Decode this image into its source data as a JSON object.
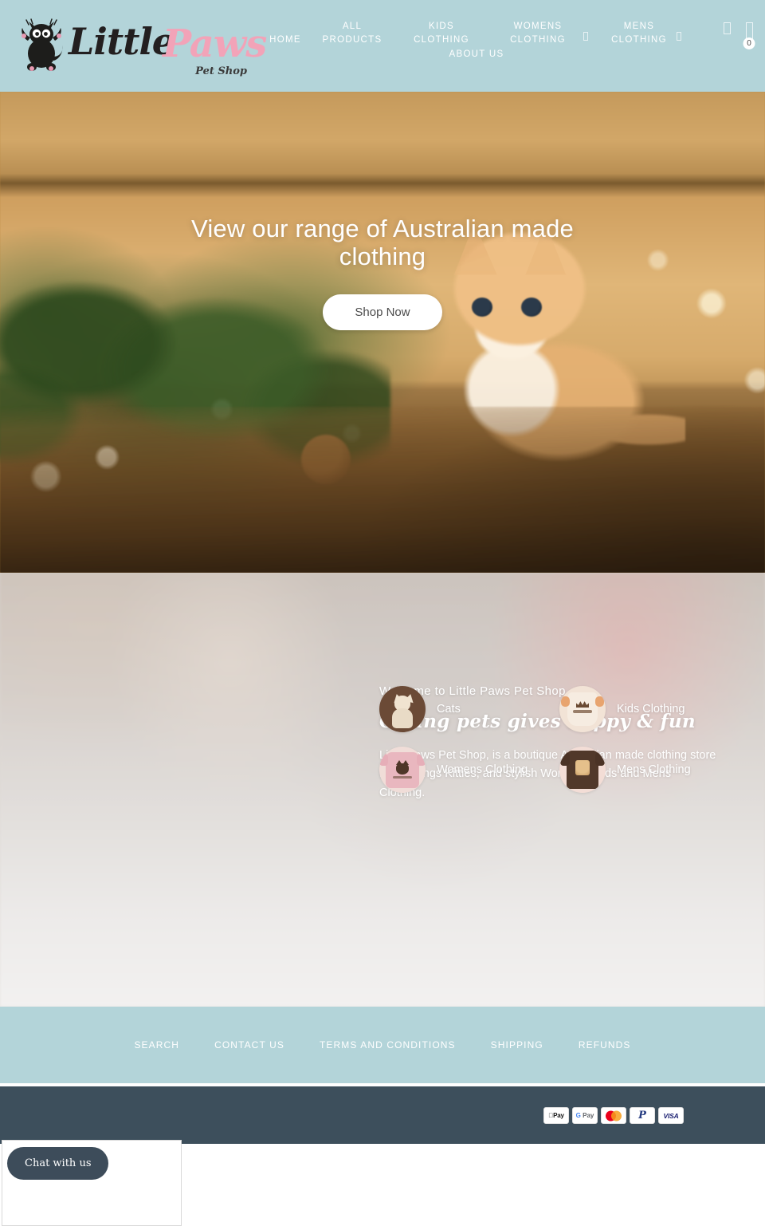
{
  "brand": {
    "name_part1": "Little",
    "name_part2": "Paws",
    "tagline": "Pet Shop",
    "logo_icon": "black-cat-logo-icon",
    "color_primary": "#b3d4d9",
    "color_accent_pink": "#f2a3b8",
    "color_dark": "#3d4f5c"
  },
  "header": {
    "nav": [
      {
        "label": "HOME",
        "has_dropdown": false
      },
      {
        "label": "ALL PRODUCTS",
        "has_dropdown": false
      },
      {
        "label": "KIDS CLOTHING",
        "has_dropdown": false
      },
      {
        "label": "WOMENS CLOTHING",
        "has_dropdown": true
      },
      {
        "label": "MENS CLOTHING",
        "has_dropdown": true
      },
      {
        "label": "ABOUT US",
        "has_dropdown": false
      }
    ],
    "search_icon": "search-icon",
    "cart_icon": "cart-icon",
    "cart_count": "0"
  },
  "hero": {
    "title": "View our range of Australian made clothing",
    "button_label": "Shop Now",
    "image_alt": "ginger-kitten-on-wooden-ledge-with-christmas-pine"
  },
  "welcome": {
    "kicker": "Welcome to Little Paws Pet Shop",
    "heading": "Caring pets gives happy & fun",
    "body": "Little Paws Pet Shop, is a boutique Australian made clothing store for all things Kitties, and stylish Women's, Kids and Mens Clothing."
  },
  "categories": [
    {
      "label": "Cats",
      "image_alt": "cream-kitten-photo"
    },
    {
      "label": "Kids Clothing",
      "image_alt": "cream-baby-onesie-with-crown"
    },
    {
      "label": "Womens Clothing",
      "image_alt": "pink-tee-with-cat-face"
    },
    {
      "label": "Mens Clothing",
      "image_alt": "brown-tee-with-cat-graphic"
    }
  ],
  "footer": {
    "links": [
      "SEARCH",
      "CONTACT US",
      "TERMS AND CONDITIONS",
      "SHIPPING",
      "REFUNDS"
    ],
    "payments": [
      {
        "name": "apple-pay",
        "label": "Pay"
      },
      {
        "name": "google-pay",
        "label": "Pay"
      },
      {
        "name": "mastercard",
        "label": ""
      },
      {
        "name": "paypal",
        "label": "P"
      },
      {
        "name": "visa",
        "label": "VISA"
      }
    ]
  },
  "chat": {
    "button_label": "Chat with us"
  }
}
